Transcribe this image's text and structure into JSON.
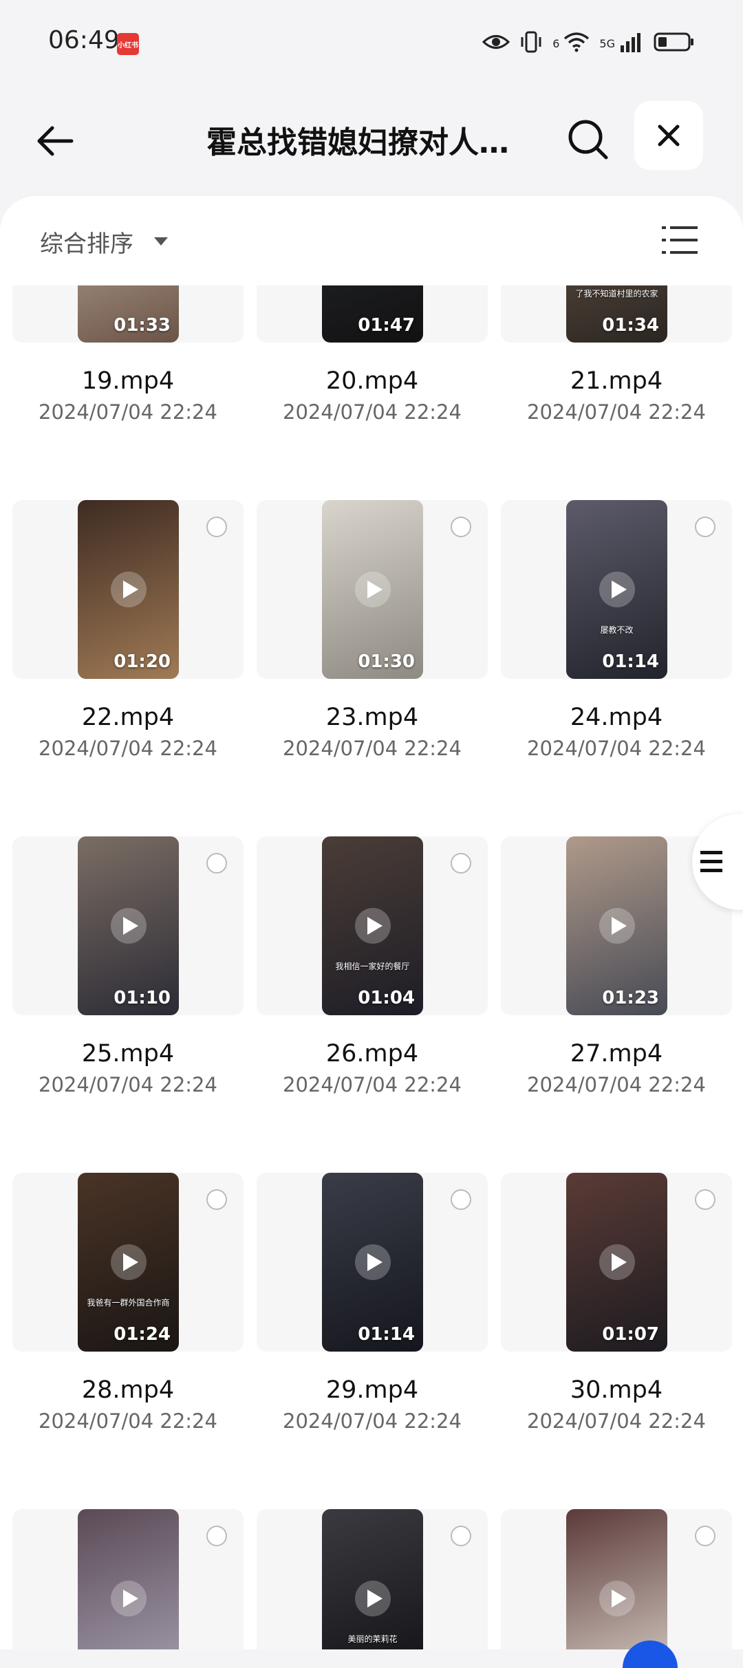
{
  "status_bar": {
    "time": "06:49",
    "app_badge": "小红书",
    "network": "5G",
    "wifi_tag": "6"
  },
  "header": {
    "title": "霍总找错媳妇撩对人…"
  },
  "sort": {
    "label": "综合排序"
  },
  "colors": {
    "accent": "#1a57e6",
    "background": "#f4f4f6"
  },
  "files": [
    {
      "name": "19.mp4",
      "date": "2024/07/04 22:24",
      "duration": "01:33",
      "caption": ""
    },
    {
      "name": "20.mp4",
      "date": "2024/07/04 22:24",
      "duration": "01:47",
      "caption": ""
    },
    {
      "name": "21.mp4",
      "date": "2024/07/04 22:24",
      "duration": "01:34",
      "caption": "了我不知道村里的农家"
    },
    {
      "name": "22.mp4",
      "date": "2024/07/04 22:24",
      "duration": "01:20",
      "caption": ""
    },
    {
      "name": "23.mp4",
      "date": "2024/07/04 22:24",
      "duration": "01:30",
      "caption": ""
    },
    {
      "name": "24.mp4",
      "date": "2024/07/04 22:24",
      "duration": "01:14",
      "caption": "屡教不改"
    },
    {
      "name": "25.mp4",
      "date": "2024/07/04 22:24",
      "duration": "01:10",
      "caption": ""
    },
    {
      "name": "26.mp4",
      "date": "2024/07/04 22:24",
      "duration": "01:04",
      "caption": "我相信一家好的餐厅"
    },
    {
      "name": "27.mp4",
      "date": "2024/07/04 22:24",
      "duration": "01:23",
      "caption": ""
    },
    {
      "name": "28.mp4",
      "date": "2024/07/04 22:24",
      "duration": "01:24",
      "caption": "我爸有一群外国合作商"
    },
    {
      "name": "29.mp4",
      "date": "2024/07/04 22:24",
      "duration": "01:14",
      "caption": ""
    },
    {
      "name": "30.mp4",
      "date": "2024/07/04 22:24",
      "duration": "01:07",
      "caption": ""
    },
    {
      "name": "",
      "date": "",
      "duration": "",
      "caption": ""
    },
    {
      "name": "",
      "date": "",
      "duration": "",
      "caption": "美丽的茉莉花"
    },
    {
      "name": "",
      "date": "",
      "duration": "",
      "caption": ""
    }
  ]
}
